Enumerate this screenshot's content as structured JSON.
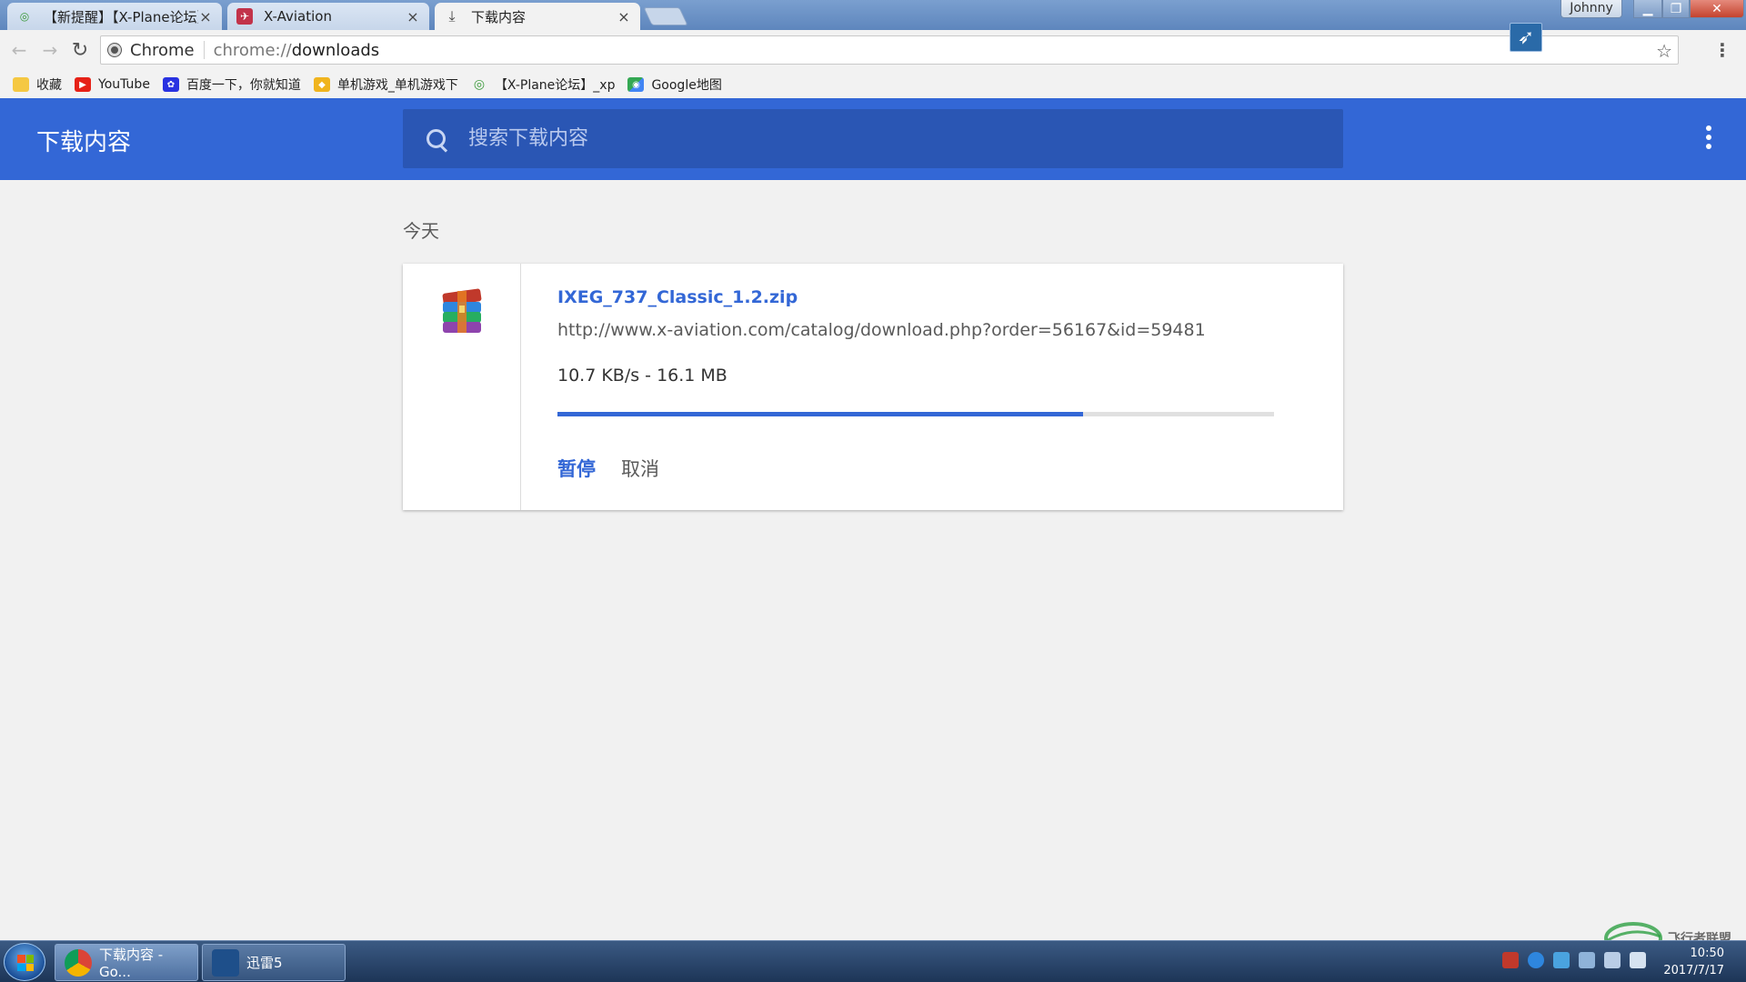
{
  "tabs": [
    {
      "title": "【新提醒】【X-Plane论坛】",
      "active": false
    },
    {
      "title": "X-Aviation",
      "active": false
    },
    {
      "title": "下载内容",
      "active": true
    }
  ],
  "window": {
    "profile_name": "Johnny"
  },
  "omnibox": {
    "chip_label": "Chrome",
    "scheme": "chrome://",
    "path": "downloads"
  },
  "bookmarks": [
    {
      "label": "收藏",
      "icon": "folder-icon"
    },
    {
      "label": "YouTube",
      "icon": "youtube-icon"
    },
    {
      "label": "百度一下，你就知道",
      "icon": "baidu-paw-icon"
    },
    {
      "label": "单机游戏_单机游戏下",
      "icon": "game-site-icon"
    },
    {
      "label": "【X-Plane论坛】_xp",
      "icon": "xplane-forum-icon"
    },
    {
      "label": "Google地图",
      "icon": "google-maps-icon"
    }
  ],
  "downloads_page": {
    "title": "下载内容",
    "search_placeholder": "搜索下载内容",
    "section_label": "今天"
  },
  "download_item": {
    "file_name": "IXEG_737_Classic_1.2.zip",
    "url": "http://www.x-aviation.com/catalog/download.php?order=56167&id=59481",
    "status": "10.7 KB/s - 16.1 MB",
    "progress_fraction": 0.734,
    "pause_label": "暂停",
    "cancel_label": "取消",
    "file_icon": "winrar-archive-icon"
  },
  "taskbar": {
    "items": [
      {
        "label": "下载内容 - Go...",
        "icon": "chrome-icon"
      },
      {
        "label": "迅雷5",
        "icon": "thunder-icon"
      }
    ],
    "clock_time": "10:50",
    "clock_date": "2017/7/17"
  },
  "watermark": {
    "text": "飞行者联盟"
  },
  "colors": {
    "accent": "#3367d6",
    "header_search_bg": "#2a56b4",
    "page_bg": "#f1f1f1",
    "progress_track": "#e0e0e0"
  }
}
